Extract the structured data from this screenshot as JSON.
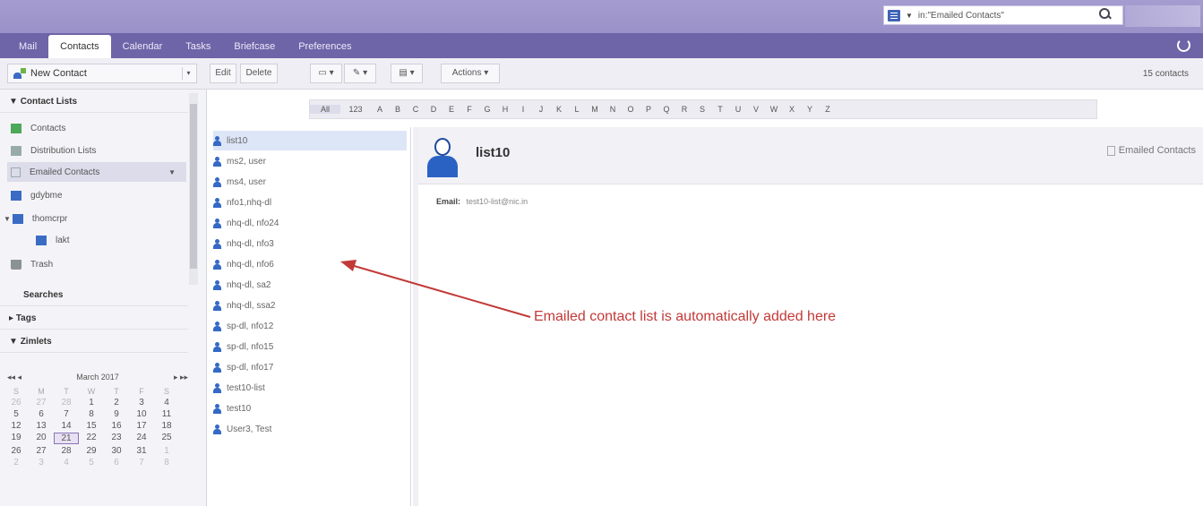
{
  "search": {
    "query": "in:\"Emailed Contacts\""
  },
  "app_tabs": [
    "Mail",
    "Contacts",
    "Calendar",
    "Tasks",
    "Briefcase",
    "Preferences"
  ],
  "toolbar": {
    "new_contact": "New Contact",
    "edit": "Edit",
    "delete": "Delete",
    "actions": "Actions ▾",
    "contact_count": "15 contacts"
  },
  "sidebar": {
    "contact_lists_header": "Contact Lists",
    "items": [
      "Contacts",
      "Distribution Lists",
      "Emailed Contacts",
      "gdybme",
      "thomcrpr",
      "lakt",
      "Trash"
    ],
    "searches_header": "Searches",
    "tags_header": "Tags",
    "zimlets_header": "Zimlets"
  },
  "calendar": {
    "title": "March 2017",
    "nav_prev": "◂◂  ◂",
    "nav_next": "▸  ▸▸",
    "dow": [
      "S",
      "M",
      "T",
      "W",
      "T",
      "F",
      "S"
    ],
    "weeks": [
      [
        "26",
        "27",
        "28",
        "1",
        "2",
        "3",
        "4"
      ],
      [
        "5",
        "6",
        "7",
        "8",
        "9",
        "10",
        "11"
      ],
      [
        "12",
        "13",
        "14",
        "15",
        "16",
        "17",
        "18"
      ],
      [
        "19",
        "20",
        "21",
        "22",
        "23",
        "24",
        "25"
      ],
      [
        "26",
        "27",
        "28",
        "29",
        "30",
        "31",
        "1"
      ],
      [
        "2",
        "3",
        "4",
        "5",
        "6",
        "7",
        "8"
      ]
    ],
    "today": "21"
  },
  "alphabet": [
    "All",
    "123",
    "A",
    "B",
    "C",
    "D",
    "E",
    "F",
    "G",
    "H",
    "I",
    "J",
    "K",
    "L",
    "M",
    "N",
    "O",
    "P",
    "Q",
    "R",
    "S",
    "T",
    "U",
    "V",
    "W",
    "X",
    "Y",
    "Z"
  ],
  "contacts": [
    "list10",
    "ms2, user",
    "ms4, user",
    "nfo1,nhq-dl",
    "nhq-dl, nfo24",
    "nhq-dl, nfo3",
    "nhq-dl, nfo6",
    "nhq-dl, sa2",
    "nhq-dl, ssa2",
    "sp-dl, nfo12",
    "sp-dl, nfo15",
    "sp-dl, nfo17",
    "test10-list",
    "test10",
    "User3, Test"
  ],
  "detail": {
    "name": "list10",
    "folder": "Emailed Contacts",
    "email_label": "Email:",
    "email_value": "test10-list@nic.in"
  },
  "annotation": "Emailed contact list is automatically added here",
  "colors": {
    "annotation": "#c23a38",
    "header": "#6e64a8"
  }
}
